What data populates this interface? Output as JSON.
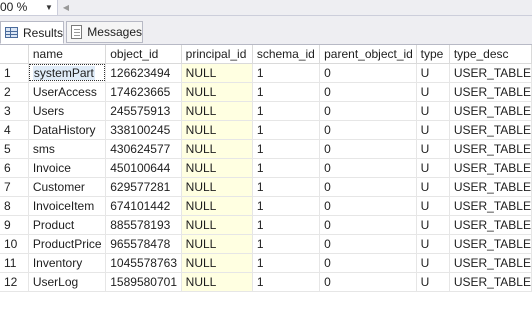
{
  "toolbar": {
    "zoom_value": "00 %"
  },
  "tabs": [
    {
      "label": "Results",
      "icon": "grid-icon",
      "active": true
    },
    {
      "label": "Messages",
      "icon": "messages-icon",
      "active": false
    }
  ],
  "grid": {
    "columns": [
      "name",
      "object_id",
      "principal_id",
      "schema_id",
      "parent_object_id",
      "type",
      "type_desc"
    ],
    "rows": [
      {
        "num": "1",
        "name": "systemPart",
        "object_id": "126623494",
        "principal_id": "NULL",
        "schema_id": "1",
        "parent_object_id": "0",
        "type": "U",
        "type_desc": "USER_TABLE"
      },
      {
        "num": "2",
        "name": "UserAccess",
        "object_id": "174623665",
        "principal_id": "NULL",
        "schema_id": "1",
        "parent_object_id": "0",
        "type": "U",
        "type_desc": "USER_TABLE"
      },
      {
        "num": "3",
        "name": "Users",
        "object_id": "245575913",
        "principal_id": "NULL",
        "schema_id": "1",
        "parent_object_id": "0",
        "type": "U",
        "type_desc": "USER_TABLE"
      },
      {
        "num": "4",
        "name": "DataHistory",
        "object_id": "338100245",
        "principal_id": "NULL",
        "schema_id": "1",
        "parent_object_id": "0",
        "type": "U",
        "type_desc": "USER_TABLE"
      },
      {
        "num": "5",
        "name": "sms",
        "object_id": "430624577",
        "principal_id": "NULL",
        "schema_id": "1",
        "parent_object_id": "0",
        "type": "U",
        "type_desc": "USER_TABLE"
      },
      {
        "num": "6",
        "name": "Invoice",
        "object_id": "450100644",
        "principal_id": "NULL",
        "schema_id": "1",
        "parent_object_id": "0",
        "type": "U",
        "type_desc": "USER_TABLE"
      },
      {
        "num": "7",
        "name": "Customer",
        "object_id": "629577281",
        "principal_id": "NULL",
        "schema_id": "1",
        "parent_object_id": "0",
        "type": "U",
        "type_desc": "USER_TABLE"
      },
      {
        "num": "8",
        "name": "InvoiceItem",
        "object_id": "674101442",
        "principal_id": "NULL",
        "schema_id": "1",
        "parent_object_id": "0",
        "type": "U",
        "type_desc": "USER_TABLE"
      },
      {
        "num": "9",
        "name": "Product",
        "object_id": "885578193",
        "principal_id": "NULL",
        "schema_id": "1",
        "parent_object_id": "0",
        "type": "U",
        "type_desc": "USER_TABLE"
      },
      {
        "num": "10",
        "name": "ProductPrice",
        "object_id": "965578478",
        "principal_id": "NULL",
        "schema_id": "1",
        "parent_object_id": "0",
        "type": "U",
        "type_desc": "USER_TABLE"
      },
      {
        "num": "11",
        "name": "Inventory",
        "object_id": "1045578763",
        "principal_id": "NULL",
        "schema_id": "1",
        "parent_object_id": "0",
        "type": "U",
        "type_desc": "USER_TABLE"
      },
      {
        "num": "12",
        "name": "UserLog",
        "object_id": "1589580701",
        "principal_id": "NULL",
        "schema_id": "1",
        "parent_object_id": "0",
        "type": "U",
        "type_desc": "USER_TABLE"
      }
    ]
  },
  "colors": {
    "null_cell_background": "#ffffe1",
    "selection": "#e0ecf8"
  }
}
